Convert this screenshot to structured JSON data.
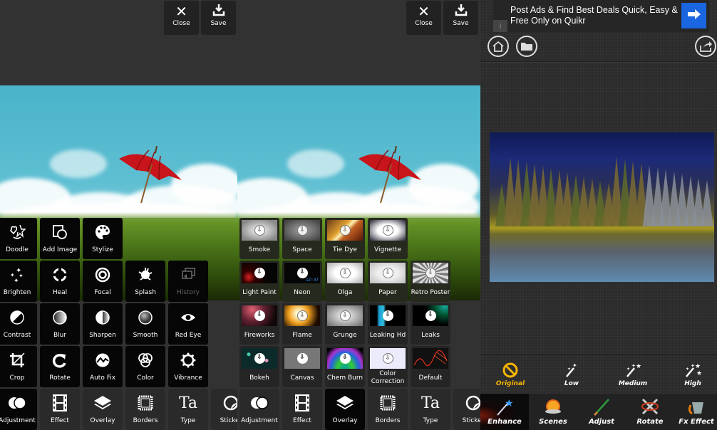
{
  "panels": [
    {
      "top_buttons": {
        "close": "Close",
        "save": "Save"
      },
      "tools": [
        [
          "Doodle",
          "Add Image",
          "Stylize"
        ],
        [
          "Brighten",
          "Heal",
          "Focal",
          "Splash",
          "History"
        ],
        [
          "Contrast",
          "Blur",
          "Sharpen",
          "Smooth",
          "Red Eye"
        ],
        [
          "Crop",
          "Rotate",
          "Auto Fix",
          "Color",
          "Vibrance"
        ],
        [
          "Adjustment",
          "Effect",
          "Overlay",
          "Borders",
          "Type",
          "Sticker"
        ]
      ],
      "disabled_tools": [
        "History"
      ]
    },
    {
      "top_buttons": {
        "close": "Close",
        "save": "Save"
      },
      "overlays": [
        [
          "Smoke",
          "Space",
          "Tie Dye",
          "Vignette"
        ],
        [
          "Light Paint",
          "Neon",
          "Olga",
          "Paper",
          "Retro Poster"
        ],
        [
          "Fireworks",
          "Flame",
          "Grunge",
          "Leaking Hd",
          "Leaks"
        ],
        [
          "Bokeh",
          "Canvas",
          "Chem Burn",
          "Color Correction",
          "Default"
        ]
      ],
      "neon_clock": "12:37",
      "categories": [
        "Adjustment",
        "Effect",
        "Overlay",
        "Borders",
        "Type",
        "Sticker"
      ],
      "selected_category": "Overlay"
    },
    {
      "ad": {
        "text": "Post Ads & Find Best Deals Quick, Easy & Free Only on Quikr",
        "info": "i",
        "arrow": "→"
      },
      "top_icons": [
        "home-icon",
        "folder-icon",
        "share-icon"
      ],
      "enhance_levels": [
        "Original",
        "Low",
        "Medium",
        "High"
      ],
      "selected_level": "Original",
      "tabs": [
        "Enhance",
        "Scenes",
        "Adjust",
        "Rotate",
        "Fx Effect"
      ],
      "selected_tab": "Enhance",
      "colors": {
        "accent": "#f5b400",
        "ad_button": "#1a66e0"
      }
    }
  ]
}
